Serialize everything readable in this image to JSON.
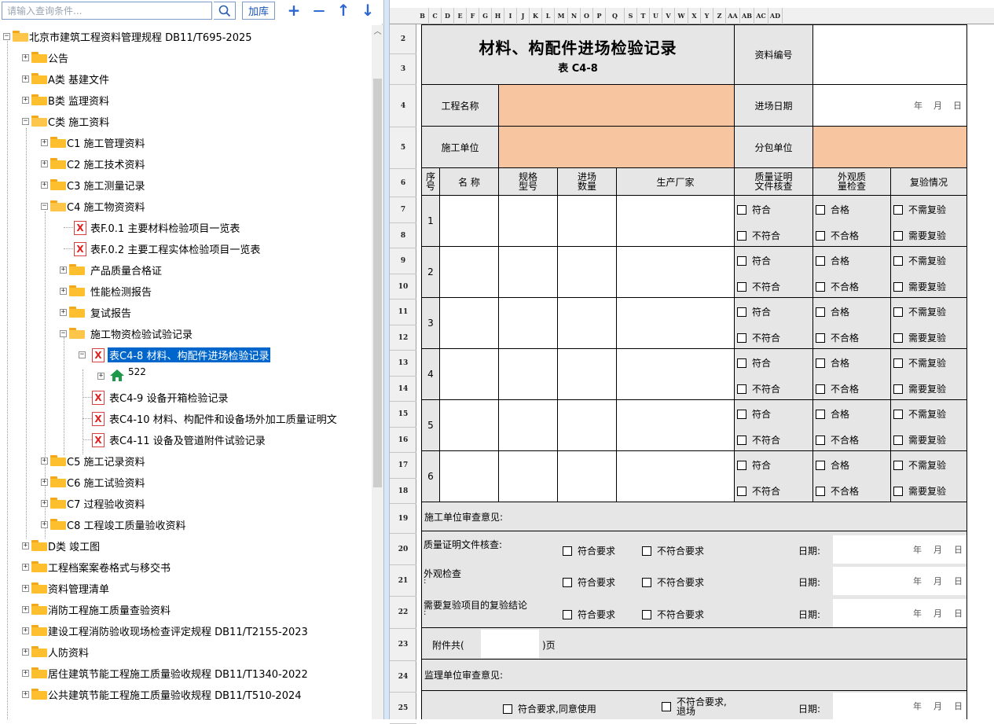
{
  "toolbar": {
    "search_placeholder": "请输入查询条件...",
    "load_label": "加库",
    "add_symbol": "+",
    "remove_symbol": "—",
    "up_symbol": "↑",
    "down_symbol": "↓"
  },
  "tree": {
    "root": "北京市建筑工程资料管理规程 DB11/T695-2025",
    "n_gonggao": "公告",
    "n_a": "A类 基建文件",
    "n_b": "B类 监理资料",
    "n_c": "C类 施工资料",
    "n_c1": "C1 施工管理资料",
    "n_c2": "C2 施工技术资料",
    "n_c3": "C3 施工测量记录",
    "n_c4": "C4 施工物资资料",
    "n_f1": "表F.0.1 主要材料检验项目一览表",
    "n_f2": "表F.0.2 主要工程实体检验项目一览表",
    "n_cert": "产品质量合格证",
    "n_perf": "性能检测报告",
    "n_retest": "复试报告",
    "n_insp": "施工物资检验试验记录",
    "n_c48": "表C4-8 材料、构配件进场检验记录",
    "n_522": "522",
    "n_c49": "表C4-9 设备开箱检验记录",
    "n_c410": "表C4-10 材料、构配件和设备场外加工质量证明文",
    "n_c411": "表C4-11 设备及管道附件试验记录",
    "n_c5": "C5 施工记录资料",
    "n_c6": "C6 施工试验资料",
    "n_c7": "C7 过程验收资料",
    "n_c8": "C8 工程竣工质量验收资料",
    "n_d": "D类 竣工图",
    "n_arch": "工程档案案卷格式与移交书",
    "n_list": "资料管理清单",
    "n_fire": "消防工程施工质量查验资料",
    "n_fire2": "建设工程消防验收现场检查评定规程 DB11/T2155-2023",
    "n_rf": "人防资料",
    "n_res": "居住建筑节能工程施工质量验收规程 DB11/T1340-2022",
    "n_pub": "公共建筑节能工程施工质量验收规程 DB11/T510-2024"
  },
  "columns": [
    "B",
    "C",
    "D",
    "E",
    "F",
    "G",
    "H",
    "I",
    "J",
    "K",
    "L",
    "M",
    "N",
    "O",
    "P",
    "Q",
    "S",
    "T",
    "U",
    "V",
    "W",
    "X",
    "Y",
    "Z",
    "AA",
    "AB",
    "AC",
    "AD"
  ],
  "rows": [
    "2",
    "3",
    "4",
    "5",
    "6",
    "7",
    "8",
    "9",
    "10",
    "11",
    "12",
    "13",
    "14",
    "15",
    "16",
    "17",
    "18",
    "19",
    "20",
    "21",
    "22",
    "23",
    "24",
    "25"
  ],
  "form": {
    "title": "材料、构配件进场检验记录",
    "subtitle": "表 C4-8",
    "doc_no_label": "资料编号",
    "project_label": "工程名称",
    "entry_date_label": "进场日期",
    "year": "年",
    "month": "月",
    "day": "日",
    "contractor_label": "施工单位",
    "sub_label": "分包单位",
    "col_seq": "序号",
    "col_name": "名  称",
    "col_spec": "规格型号",
    "col_qty": "进场数量",
    "col_maker": "生产厂家",
    "col_cert": "质量证明文件核查",
    "col_appear": "外观质量检查",
    "col_retest": "复验情况",
    "opt_conform": "符合",
    "opt_nonconform": "不符合",
    "opt_pass": "合格",
    "opt_fail": "不合格",
    "opt_noretest": "不需复验",
    "opt_retest": "需要复验",
    "items": [
      "1",
      "2",
      "3",
      "4",
      "5",
      "6"
    ],
    "review_label": "施工单位审查意见:",
    "cert_check": "质量证明文件核查:",
    "appear_check": "外观检查",
    "colon": ":",
    "retest_concl": "需要复验项目的复验结论",
    "meets": "符合要求",
    "not_meets": "不符合要求",
    "date_label": "日期:",
    "attach_pre": "附件共(",
    "attach_post": ")页",
    "supervisor_label": "监理单位审查意见:",
    "agree_use": "符合要求,同意使用",
    "reject": "不符合要求,退场"
  }
}
